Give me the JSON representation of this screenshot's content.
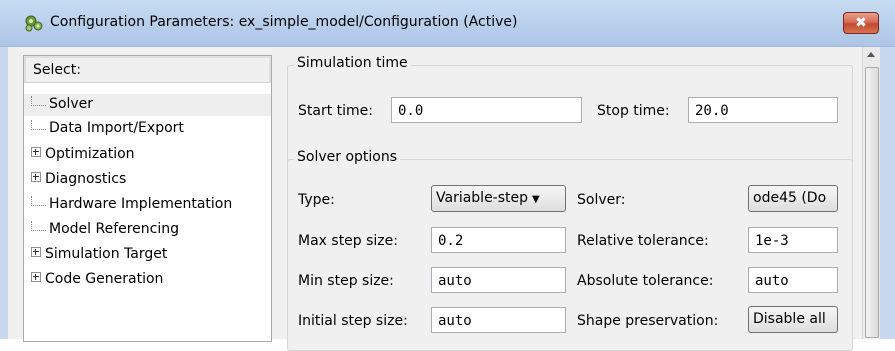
{
  "window": {
    "title": "Configuration Parameters: ex_simple_model/Configuration (Active)",
    "close_label": "✖",
    "icon": "gear-cluster-icon"
  },
  "select_panel": {
    "header": "Select:",
    "items": [
      {
        "label": "Solver",
        "expandable": false,
        "selected": true
      },
      {
        "label": "Data Import/Export",
        "expandable": false,
        "selected": false
      },
      {
        "label": "Optimization",
        "expandable": true,
        "selected": false
      },
      {
        "label": "Diagnostics",
        "expandable": true,
        "selected": false
      },
      {
        "label": "Hardware Implementation",
        "expandable": false,
        "selected": false
      },
      {
        "label": "Model Referencing",
        "expandable": false,
        "selected": false
      },
      {
        "label": "Simulation Target",
        "expandable": true,
        "selected": false
      },
      {
        "label": "Code Generation",
        "expandable": true,
        "selected": false
      }
    ]
  },
  "simulation_time": {
    "title": "Simulation time",
    "start_label": "Start time:",
    "start_value": "0.0",
    "stop_label": "Stop time:",
    "stop_value": "20.0"
  },
  "solver_options": {
    "title": "Solver options",
    "type_label": "Type:",
    "type_value": "Variable-step",
    "solver_label": "Solver:",
    "solver_value": "ode45 (Do",
    "max_step_label": "Max step size:",
    "max_step_value": "0.2",
    "rel_tol_label": "Relative tolerance:",
    "rel_tol_value": "1e-3",
    "min_step_label": "Min step size:",
    "min_step_value": "auto",
    "abs_tol_label": "Absolute tolerance:",
    "abs_tol_value": "auto",
    "init_step_label": "Initial step size:",
    "init_step_value": "auto",
    "shape_label": "Shape preservation:",
    "shape_value": "Disable all"
  },
  "colors": {
    "titlebar": "#b9d0ec",
    "close_button": "#c24a31",
    "panel_background": "#f0f0f0"
  }
}
